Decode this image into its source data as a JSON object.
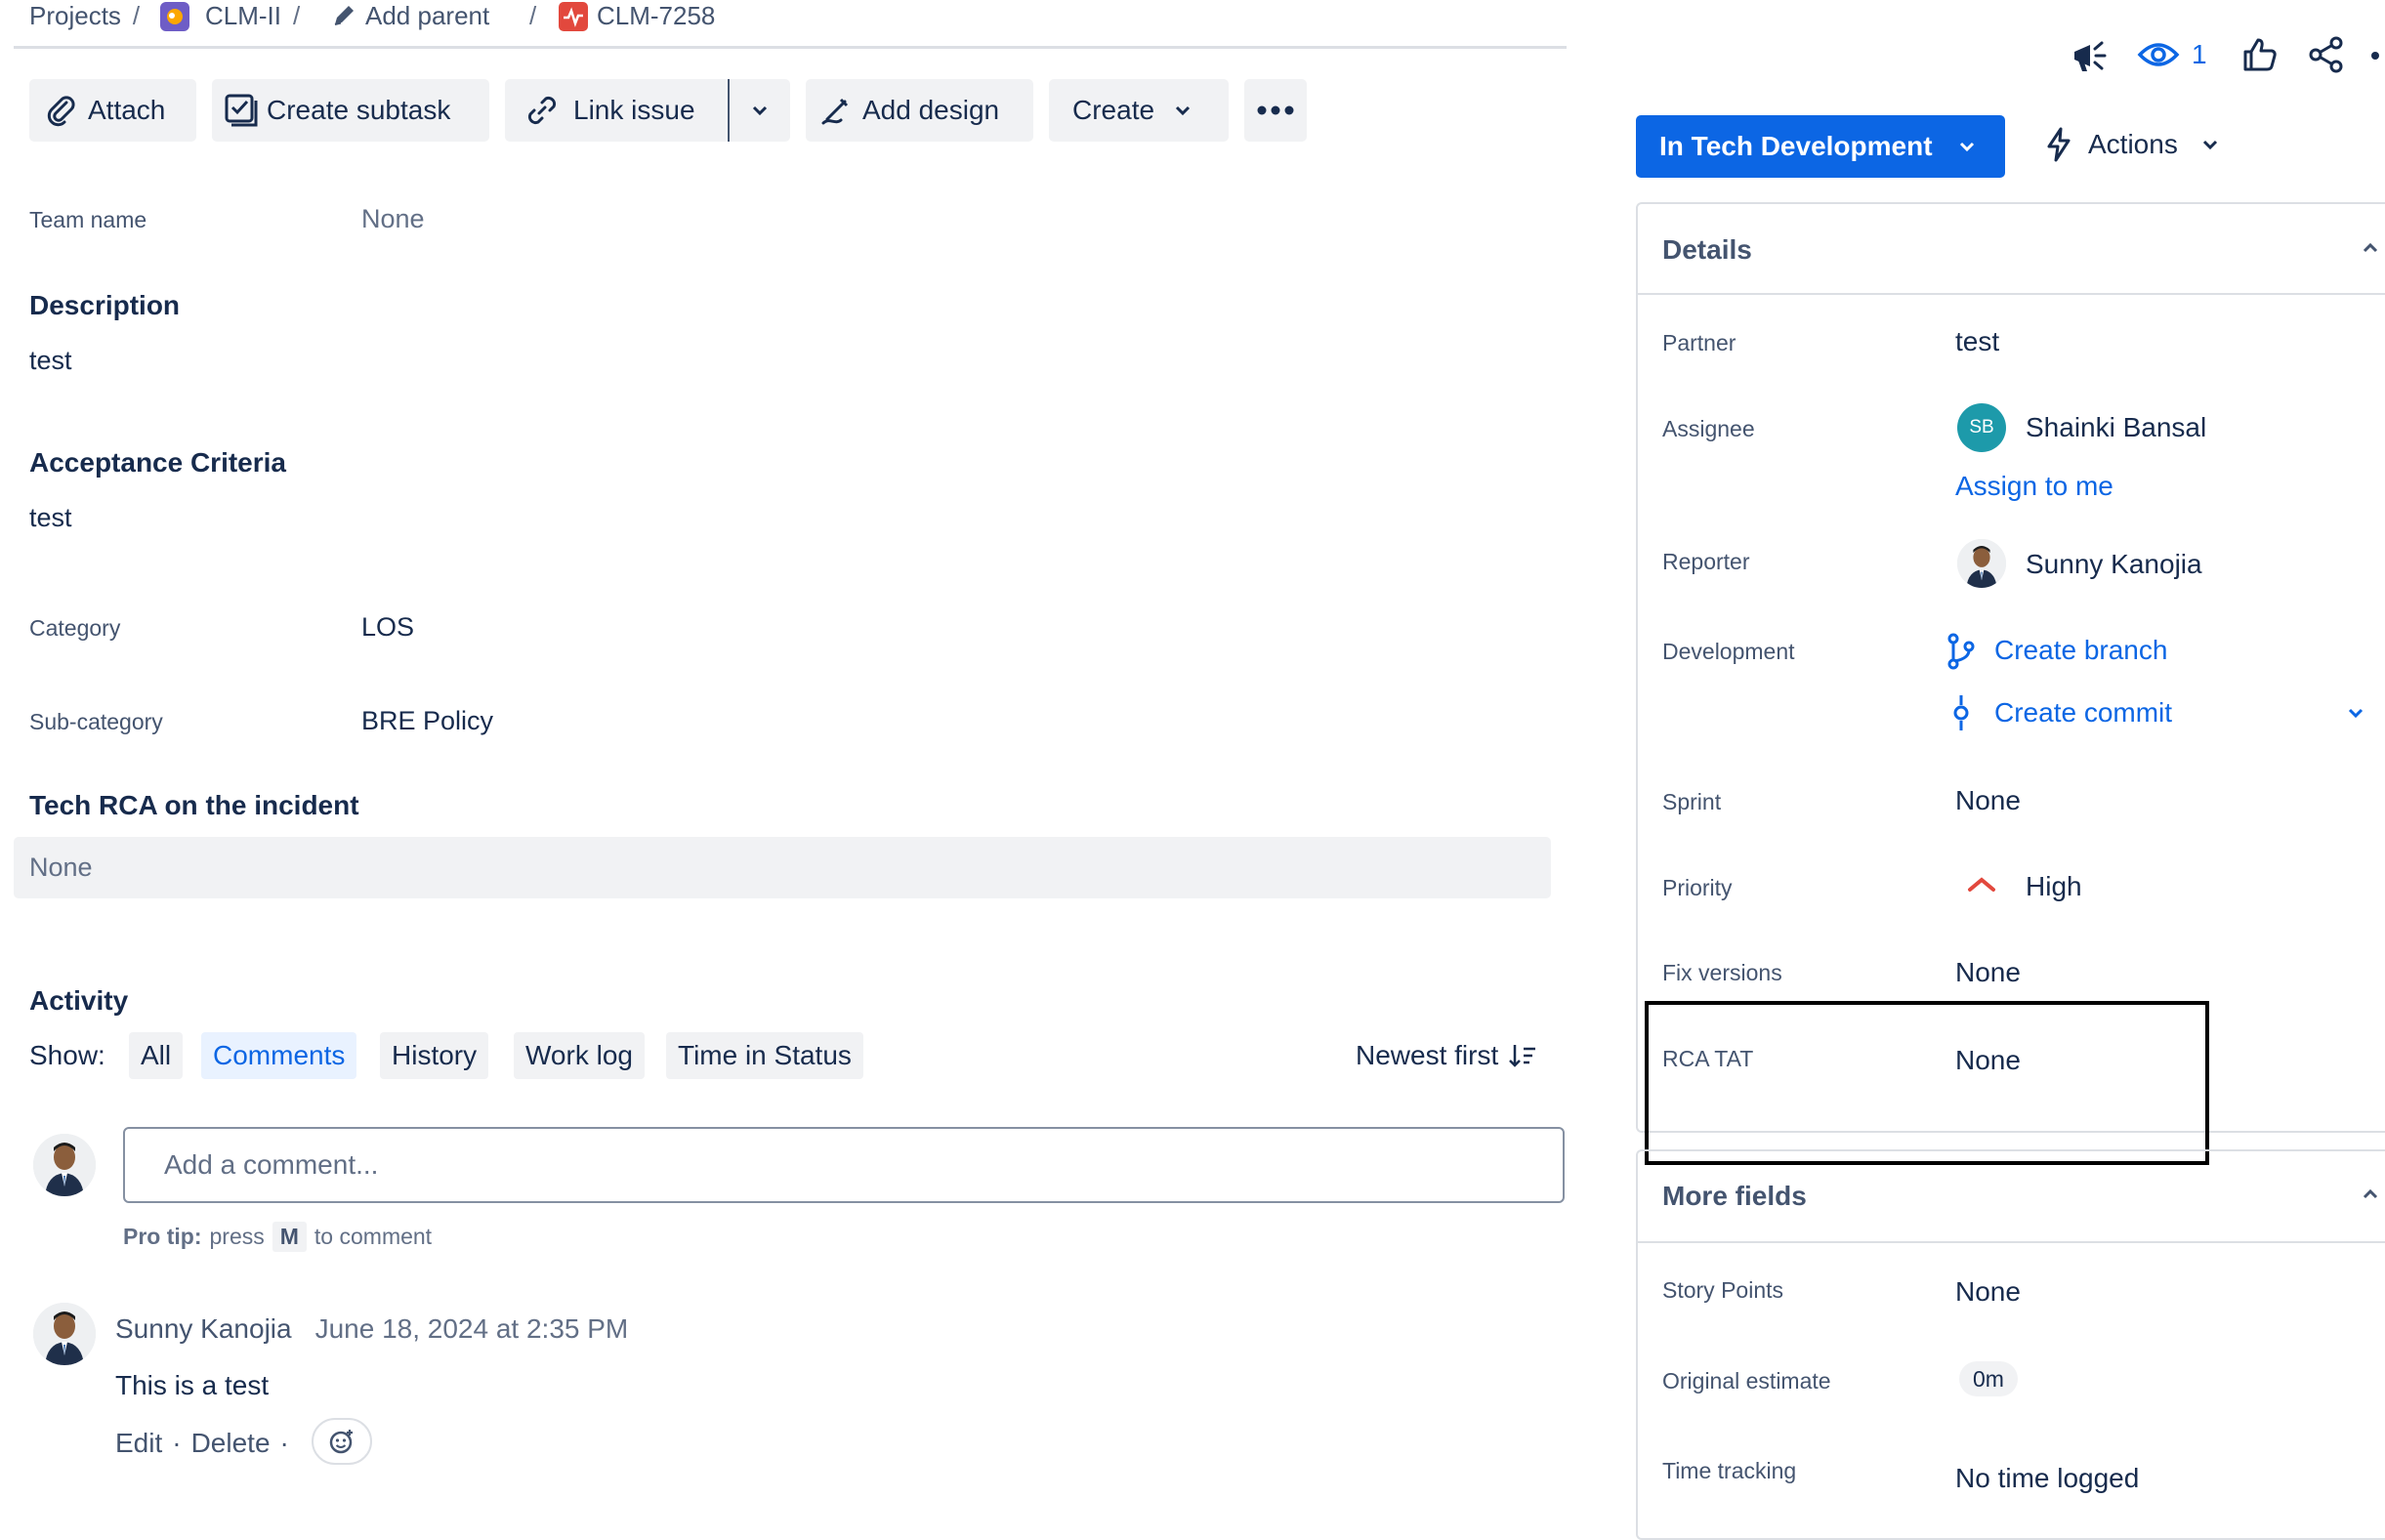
{
  "breadcrumb": {
    "projects": "Projects",
    "project": "CLM-II",
    "add_parent": "Add parent",
    "issue_key": "CLM-7258",
    "separator": "/"
  },
  "toolbar": {
    "attach": "Attach",
    "create_subtask": "Create subtask",
    "link_issue": "Link issue",
    "add_design": "Add design",
    "create": "Create"
  },
  "fields": {
    "team_name_label": "Team name",
    "team_name_value": "None",
    "description_heading": "Description",
    "description_value": "test",
    "acceptance_heading": "Acceptance Criteria",
    "acceptance_value": "test",
    "category_label": "Category",
    "category_value": "LOS",
    "subcategory_label": "Sub-category",
    "subcategory_value": "BRE Policy",
    "tech_rca_heading": "Tech RCA on the incident",
    "tech_rca_value": "None"
  },
  "activity": {
    "heading": "Activity",
    "show_label": "Show:",
    "filters": [
      "All",
      "Comments",
      "History",
      "Work log",
      "Time in Status"
    ],
    "active_filter": "Comments",
    "sort": "Newest first",
    "comment_placeholder": "Add a comment...",
    "pro_tip_prefix": "Pro tip:",
    "pro_tip_press": "press",
    "pro_tip_key": "M",
    "pro_tip_suffix": "to comment",
    "comments": [
      {
        "author": "Sunny Kanojia",
        "timestamp": "June 18, 2024 at 2:35 PM",
        "body": "This is a test",
        "edit": "Edit",
        "delete": "Delete",
        "dot": "·"
      }
    ]
  },
  "header_actions": {
    "watch_count": "1"
  },
  "status": {
    "label": "In Tech Development",
    "actions": "Actions"
  },
  "details": {
    "heading": "Details",
    "partner_label": "Partner",
    "partner_value": "test",
    "assignee_label": "Assignee",
    "assignee_initials": "SB",
    "assignee_name": "Shainki Bansal",
    "assign_to_me": "Assign to me",
    "reporter_label": "Reporter",
    "reporter_name": "Sunny Kanojia",
    "development_label": "Development",
    "create_branch": "Create branch",
    "create_commit": "Create commit",
    "sprint_label": "Sprint",
    "sprint_value": "None",
    "priority_label": "Priority",
    "priority_value": "High",
    "fix_versions_label": "Fix versions",
    "fix_versions_value": "None",
    "rca_tat_label": "RCA TAT",
    "rca_tat_value": "None"
  },
  "more_fields": {
    "heading": "More fields",
    "story_points_label": "Story Points",
    "story_points_value": "None",
    "original_estimate_label": "Original estimate",
    "original_estimate_value": "0m",
    "time_tracking_label": "Time tracking",
    "time_tracking_value": "No time logged"
  },
  "colors": {
    "primary": "#0c66e4",
    "priority_high": "#e2483d",
    "assignee_avatar": "#1d9aaa",
    "highlight_border": "#000000"
  }
}
